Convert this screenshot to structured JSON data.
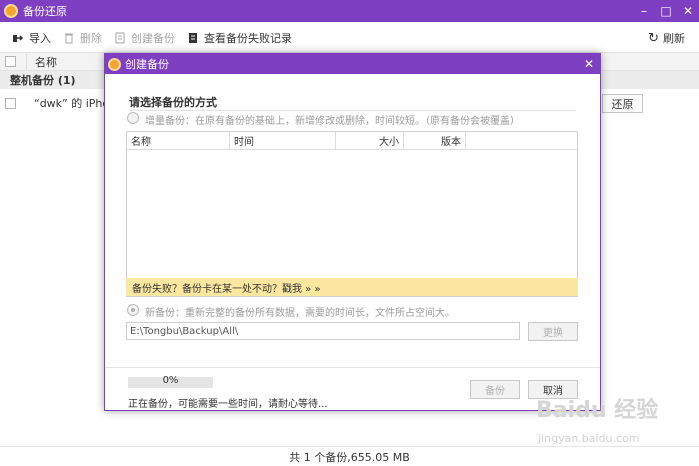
{
  "window": {
    "title": "备份还原"
  },
  "toolbar": {
    "import_label": "导入",
    "delete_label": "删除",
    "create_label": "创建备份",
    "failed_log_label": "查看备份失败记录",
    "refresh_label": "刷新"
  },
  "list": {
    "col_name": "名称",
    "group_label": "整机备份 (1)",
    "row_name": "“dwk” 的 iPhone",
    "restore_label": "还原"
  },
  "status": {
    "summary": "共 1 个备份,655.05 MB"
  },
  "dialog": {
    "title": "创建备份",
    "section_title": "请选择备份的方式",
    "incremental_label": "增量备份：在原有备份的基础上，新增修改或删除，时间较短。（原有备份会被覆盖）",
    "columns": {
      "name": "名称",
      "time": "时间",
      "size": "大小",
      "version": "版本"
    },
    "warning_text": "备份失败？备份卡在某一处不动？戳我 » »",
    "new_backup_label": "新备份：重新完整的备份所有数据，需要的时间长，文件所占空间大。",
    "path_value": "E:\\Tongbu\\Backup\\All\\",
    "change_label": "更换",
    "progress_text": "0%",
    "progress_value": 0,
    "busy_text": "正在备份，可能需要一些时间，请耐心等待...",
    "backup_button": "备份",
    "cancel_button": "取消"
  },
  "watermark": {
    "text": "Baidu 经验",
    "sub": "jingyan.baidu.com"
  },
  "colors": {
    "accent": "#7e3fc2",
    "warn_bg": "#fbe7a0"
  }
}
